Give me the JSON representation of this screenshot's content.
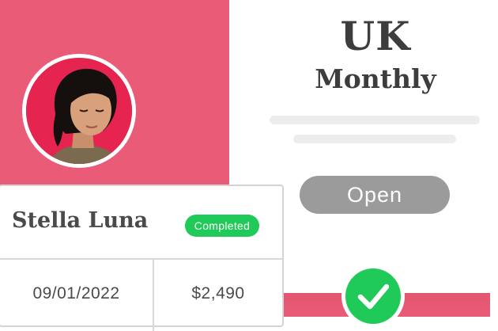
{
  "plan": {
    "region": "UK",
    "period": "Monthly",
    "button_label": "Open"
  },
  "customer": {
    "name": "Stella Luna",
    "status": "Completed",
    "date": "09/01/2022",
    "amount": "$2,490"
  },
  "icons": {
    "avatar": "user-photo",
    "status_check": "checkmark-icon"
  },
  "colors": {
    "brand_pink": "#ea5b78",
    "avatar_background": "#e5254f",
    "success_green": "#1fca59",
    "button_gray": "#9b9b9b",
    "text_dark": "#3d3d3d"
  }
}
